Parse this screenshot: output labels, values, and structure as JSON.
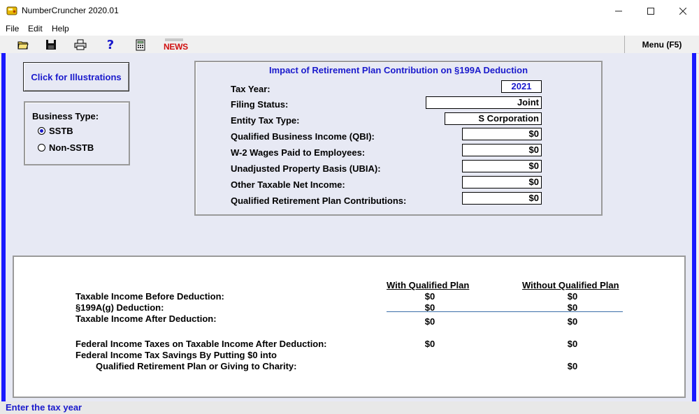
{
  "window": {
    "title": "NumberCruncher 2020.01"
  },
  "menu": [
    "File",
    "Edit",
    "Help"
  ],
  "toolbar": {
    "news_label": "NEWS",
    "menu_label": "Menu (F5)"
  },
  "illustrations_button": "Click for Illustrations",
  "business_type": {
    "label": "Business Type:",
    "options": [
      {
        "label": "SSTB",
        "selected": true
      },
      {
        "label": "Non-SSTB",
        "selected": false
      }
    ]
  },
  "input_panel": {
    "title": "Impact of Retirement Plan Contribution on §199A Deduction",
    "fields": [
      {
        "label": "Tax Year:",
        "value": "2021"
      },
      {
        "label": "Filing Status:",
        "value": "Joint"
      },
      {
        "label": "Entity Tax Type:",
        "value": "S Corporation"
      },
      {
        "label": "Qualified Business Income (QBI):",
        "value": "$0"
      },
      {
        "label": "W-2 Wages Paid to Employees:",
        "value": "$0"
      },
      {
        "label": "Unadjusted Property Basis (UBIA):",
        "value": "$0"
      },
      {
        "label": "Other Taxable Net Income:",
        "value": "$0"
      },
      {
        "label": "Qualified Retirement Plan Contributions:",
        "value": "$0"
      }
    ]
  },
  "results": {
    "col_with": "With Qualified Plan",
    "col_without": "Without Qualified Plan",
    "rows": [
      {
        "label": "Taxable Income Before Deduction:",
        "with": "$0",
        "without": "$0"
      },
      {
        "label": "§199A(g) Deduction:",
        "with": "$0",
        "without": "$0"
      },
      {
        "label": "Taxable Income After Deduction:",
        "with": "$0",
        "without": "$0"
      },
      {
        "label": "Federal Income Taxes on Taxable Income After Deduction:",
        "with": "$0",
        "without": "$0"
      }
    ],
    "savings_line1": "Federal Income Tax Savings By Putting $0 into",
    "savings_line2": "Qualified Retirement Plan or Giving to Charity:",
    "savings_value": "$0"
  },
  "status_text": "Enter the tax year",
  "colors": {
    "accent_blue": "#1a1acc",
    "side_border": "#1a1aff",
    "news_red": "#d01010"
  }
}
